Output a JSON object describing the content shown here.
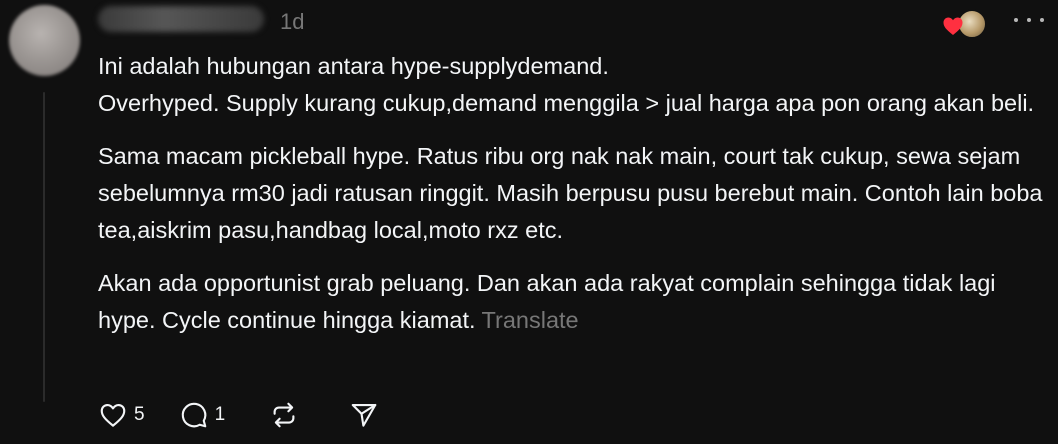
{
  "post": {
    "timestamp": "1d",
    "paragraphs": [
      {
        "line1": "Ini adalah hubungan antara hype-supplydemand.",
        "line2": "Overhyped. Supply kurang cukup,demand menggila > jual harga apa pon orang akan beli."
      },
      {
        "text": "Sama macam pickleball hype. Ratus ribu org nak nak main, court tak cukup, sewa sejam sebelumnya rm30 jadi ratusan ringgit. Masih berpusu pusu berebut main. Contoh lain boba tea,aiskrim pasu,handbag local,moto rxz etc."
      },
      {
        "text": "Akan ada opportunist grab peluang. Dan akan ada rakyat complain sehingga tidak lagi hype. Cycle continue hingga kiamat."
      }
    ],
    "translate_label": "Translate"
  },
  "actions": {
    "like_count": "5",
    "reply_count": "1"
  },
  "icons": {
    "more": "more-horizontal-icon",
    "like": "heart-outline-icon",
    "reply": "speech-bubble-icon",
    "repost": "repost-arrows-icon",
    "share": "paper-plane-icon",
    "reaction": "heart-filled-icon"
  },
  "colors": {
    "background": "#101010",
    "text": "#f3f5f7",
    "muted": "#777777",
    "reaction_heart": "#ff3040"
  }
}
